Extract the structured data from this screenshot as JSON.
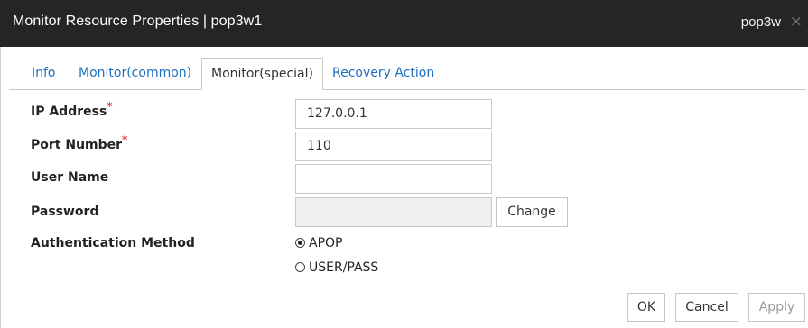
{
  "window": {
    "title": "Monitor Resource Properties | pop3w1",
    "title_right": "pop3w",
    "close_glyph": "×"
  },
  "tabs": [
    {
      "label": "Info",
      "active": false
    },
    {
      "label": "Monitor(common)",
      "active": false
    },
    {
      "label": "Monitor(special)",
      "active": true
    },
    {
      "label": "Recovery Action",
      "active": false
    }
  ],
  "form": {
    "ip_address": {
      "label": "IP Address",
      "required_mark": "*",
      "value": "127.0.0.1"
    },
    "port_number": {
      "label": "Port Number",
      "required_mark": "*",
      "value": "110"
    },
    "user_name": {
      "label": "User Name",
      "value": ""
    },
    "password": {
      "label": "Password",
      "value": "",
      "change_label": "Change"
    },
    "auth_method": {
      "label": "Authentication Method",
      "options": [
        {
          "label": "APOP",
          "selected": true
        },
        {
          "label": "USER/PASS",
          "selected": false
        }
      ]
    }
  },
  "footer": {
    "ok_label": "OK",
    "cancel_label": "Cancel",
    "apply_label": "Apply"
  },
  "colors": {
    "titlebar": "#252525",
    "link_tab": "#1e6fbf",
    "required": "#e83a3a"
  }
}
